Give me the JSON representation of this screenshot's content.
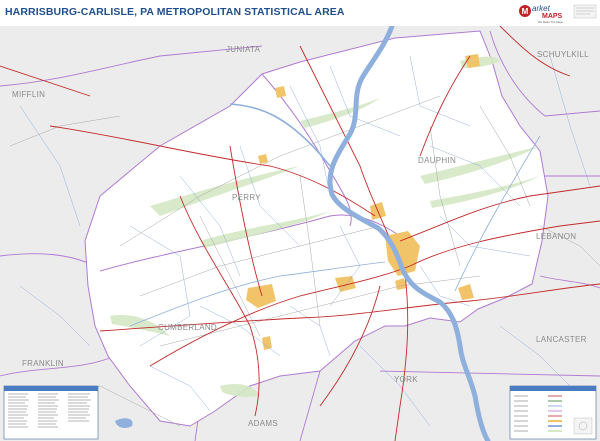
{
  "header": {
    "title": "HARRISBURG-CARLISLE, PA METROPOLITAN STATISTICAL AREA"
  },
  "logo": {
    "brand_top": "arket",
    "brand_bottom": "MAPS",
    "tagline": "We Make The Maps"
  },
  "counties": {
    "juniata": "JUNIATA",
    "schuylkill": "SCHUYLKILL",
    "mifflin": "MIFFLIN",
    "dauphin": "DAUPHIN",
    "perry": "PERRY",
    "lebanon": "LEBANON",
    "cumberland": "CUMBERLAND",
    "franklin": "FRANKLIN",
    "lancaster": "LANCASTER",
    "york": "YORK",
    "adams": "ADAMS"
  },
  "colors": {
    "title": "#1f4e8c",
    "water": "#8fb0dc",
    "outside_area": "#ececec",
    "metro_area": "#ffffff",
    "forest": "#d4e8c4",
    "urban": "#f2c46a",
    "highway": "#c22a2a",
    "county_border": "#b07ad0",
    "zip_border": "#7aa0d8"
  },
  "legend_boxes": {
    "zip_index": {
      "icon": "zip-code-index-box"
    },
    "map_legend": {
      "icon": "map-legend-box"
    }
  }
}
